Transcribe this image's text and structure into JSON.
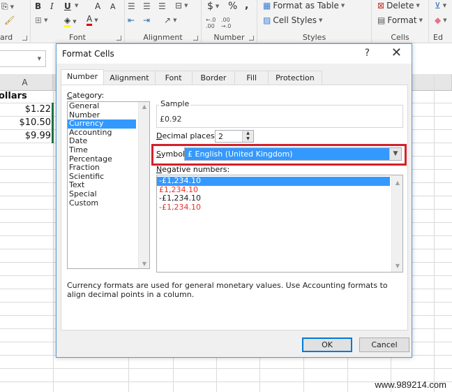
{
  "ribbon": {
    "groups": [
      {
        "label": "ard"
      },
      {
        "label": "Font"
      },
      {
        "label": "Alignment"
      },
      {
        "label": "Number"
      },
      {
        "label": "Styles"
      },
      {
        "label": "Cells"
      },
      {
        "label": "Ed"
      }
    ],
    "font": {
      "bold": "B",
      "italic": "I",
      "underline": "U",
      "grow": "A",
      "shrink": "A",
      "fontcolor": "A"
    },
    "number": {
      "currency": "$",
      "percent": "%",
      "comma": ","
    },
    "styles": {
      "format_as_table": "Format as Table",
      "cell_styles": "Cell Styles"
    },
    "cells": {
      "delete": "Delete",
      "format": "Format"
    }
  },
  "sheet": {
    "column_header_a": "A",
    "header_cell": "ollars",
    "values": [
      "$1.22",
      "$10.50",
      "$9.99"
    ]
  },
  "dialog": {
    "title": "Format Cells",
    "help": "?",
    "close": "✕",
    "tabs": [
      "Number",
      "Alignment",
      "Font",
      "Border",
      "Fill",
      "Protection"
    ],
    "active_tab": "Number",
    "category_label_u": "C",
    "category_label_rest": "ategory:",
    "categories": [
      "General",
      "Number",
      "Currency",
      "Accounting",
      "Date",
      "Time",
      "Percentage",
      "Fraction",
      "Scientific",
      "Text",
      "Special",
      "Custom"
    ],
    "selected_category": "Currency",
    "sample_label": "Sample",
    "sample_value": "£0.92",
    "decimal_label_u": "D",
    "decimal_label_rest": "ecimal places:",
    "decimal_value": "2",
    "symbol_label_u": "S",
    "symbol_label_rest": "ymbol:",
    "symbol_value": "£ English (United Kingdom)",
    "negative_label_u": "N",
    "negative_label_rest": "egative numbers:",
    "negative_numbers": [
      {
        "text": "-£1,234.10",
        "style": "selected"
      },
      {
        "text": "£1,234.10",
        "style": "red"
      },
      {
        "text": "-£1,234.10",
        "style": "normal"
      },
      {
        "text": "-£1,234.10",
        "style": "red"
      }
    ],
    "description": "Currency formats are used for general monetary values.  Use Accounting formats to align decimal points in a column.",
    "ok": "OK",
    "cancel": "Cancel",
    "highlight_color": "#d2202a",
    "selection_color": "#3399ff"
  },
  "watermark": "www.989214.com"
}
